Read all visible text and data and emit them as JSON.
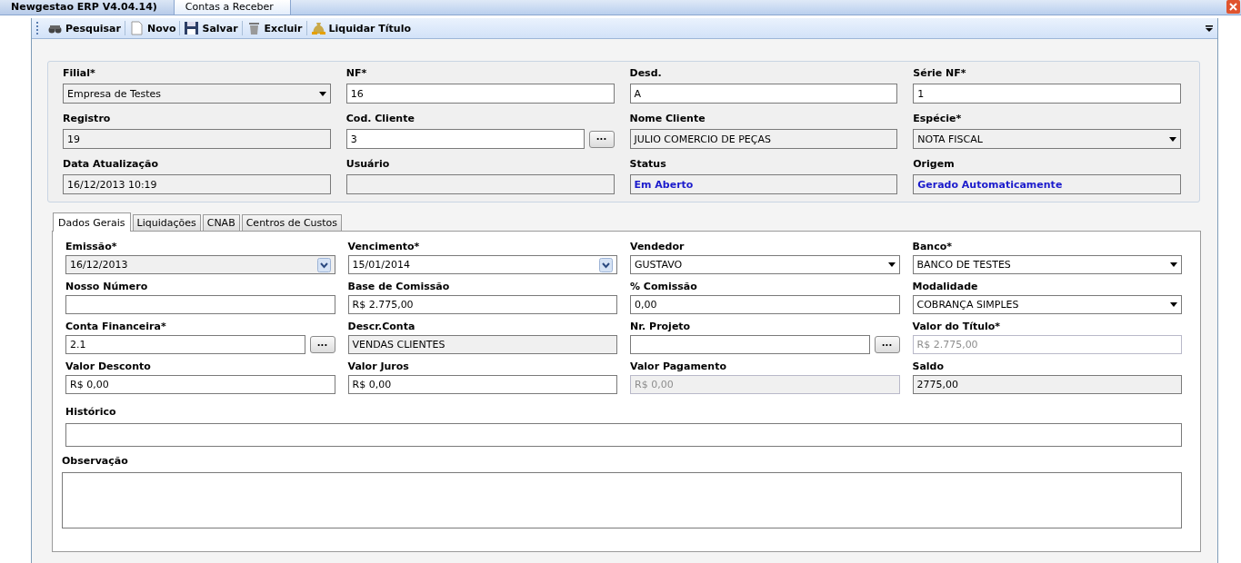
{
  "window": {
    "tabs": [
      {
        "label": "Newgestao ERP V4.04.14)",
        "selected": false
      },
      {
        "label": "Contas a Receber",
        "selected": true
      }
    ]
  },
  "toolbar": [
    {
      "label": "Pesquisar",
      "kind": "search"
    },
    {
      "label": "Novo",
      "kind": "new"
    },
    {
      "label": "Salvar",
      "kind": "save"
    },
    {
      "label": "Excluir",
      "kind": "delete"
    },
    {
      "label": "Liquidar Título",
      "kind": "settle"
    }
  ],
  "header": {
    "fields": [
      {
        "label": "Filial*",
        "value": "Empresa de Testes",
        "kind": "combo",
        "readonly": true,
        "disabled": false,
        "accent": false
      },
      {
        "label": "NF*",
        "value": "16",
        "kind": "text",
        "readonly": false,
        "disabled": false,
        "accent": false
      },
      {
        "label": "Desd.",
        "value": "A",
        "kind": "text",
        "readonly": false,
        "disabled": false,
        "accent": false
      },
      {
        "label": "Série NF*",
        "value": "1",
        "kind": "text",
        "readonly": false,
        "disabled": false,
        "accent": false
      },
      {
        "label": "Registro",
        "value": "19",
        "kind": "text",
        "readonly": true,
        "disabled": false,
        "accent": false
      },
      {
        "label": "Cod. Cliente",
        "value": "3",
        "kind": "lookup",
        "button": "...",
        "readonly": false,
        "disabled": false,
        "accent": false
      },
      {
        "label": "Nome Cliente",
        "value": "JULIO COMERCIO DE PEÇAS",
        "kind": "text",
        "readonly": true,
        "disabled": false,
        "accent": false
      },
      {
        "label": "Espécie*",
        "value": "NOTA FISCAL",
        "kind": "combo",
        "readonly": true,
        "disabled": false,
        "accent": false
      },
      {
        "label": "Data Atualização",
        "value": "16/12/2013 10:19",
        "kind": "text",
        "readonly": true,
        "disabled": false,
        "accent": false
      },
      {
        "label": "Usuário",
        "kind": "text",
        "readonly": true,
        "disabled": false
      },
      {
        "label": "Status",
        "value": "Em Aberto",
        "kind": "text",
        "readonly": true,
        "disabled": false,
        "accent": true
      },
      {
        "label": "Origem",
        "value": "Gerado Automaticamente",
        "kind": "text",
        "readonly": true,
        "disabled": false,
        "accent": true
      }
    ]
  },
  "form": {
    "tabs": [
      {
        "label": "Dados Gerais",
        "selected": true
      },
      {
        "label": "Liquidações",
        "selected": false
      },
      {
        "label": "CNAB",
        "selected": false
      },
      {
        "label": "Centros de Custos",
        "selected": false
      }
    ],
    "fields": [
      {
        "label": "Emissão*",
        "value": "16/12/2013",
        "kind": "date",
        "readonly": true,
        "disabled": false,
        "accent": false
      },
      {
        "label": "Vencimento*",
        "value": "15/01/2014",
        "kind": "date",
        "readonly": false,
        "disabled": false,
        "accent": false
      },
      {
        "label": "Vendedor",
        "value": "GUSTAVO",
        "kind": "combo",
        "readonly": false,
        "disabled": false,
        "accent": false
      },
      {
        "label": "Banco*",
        "value": "BANCO DE TESTES",
        "kind": "combo",
        "readonly": false,
        "disabled": false,
        "accent": false
      },
      {
        "label": "Nosso Número",
        "kind": "text",
        "readonly": false,
        "disabled": false
      },
      {
        "label": "Base de Comissão",
        "value": "R$ 2.775,00",
        "kind": "text",
        "readonly": false,
        "disabled": false,
        "accent": false
      },
      {
        "label": "% Comissão",
        "value": "0,00",
        "kind": "text",
        "readonly": false,
        "disabled": false,
        "accent": false
      },
      {
        "label": "Modalidade",
        "value": "COBRANÇA SIMPLES",
        "kind": "combo",
        "readonly": false,
        "disabled": false,
        "accent": false
      },
      {
        "label": "Conta Financeira*",
        "value": "2.1",
        "kind": "lookup",
        "button": "...",
        "readonly": false,
        "disabled": false,
        "accent": false
      },
      {
        "label": "Descr.Conta",
        "value": "VENDAS CLIENTES",
        "kind": "text",
        "readonly": true,
        "disabled": false,
        "accent": false
      },
      {
        "label": "Nr. Projeto",
        "kind": "lookup",
        "button": "...",
        "readonly": false,
        "disabled": false
      },
      {
        "label": "Valor do Título*",
        "value": "R$ 2.775,00",
        "kind": "text",
        "readonly": false,
        "disabled": true,
        "accent": false
      },
      {
        "label": "Valor Desconto",
        "value": "R$ 0,00",
        "kind": "text",
        "readonly": false,
        "disabled": false,
        "accent": false
      },
      {
        "label": "Valor Juros",
        "value": "R$ 0,00",
        "kind": "text",
        "readonly": false,
        "disabled": false,
        "accent": false
      },
      {
        "label": "Valor Pagamento",
        "value": "R$ 0,00",
        "kind": "text",
        "readonly": true,
        "disabled": true,
        "accent": false
      },
      {
        "label": "Saldo",
        "value": "2775,00",
        "kind": "text",
        "readonly": true,
        "disabled": false,
        "accent": false
      }
    ],
    "notes": [
      {
        "label": "Histórico",
        "kind": "line"
      },
      {
        "label": "Observação",
        "kind": "area"
      }
    ]
  }
}
